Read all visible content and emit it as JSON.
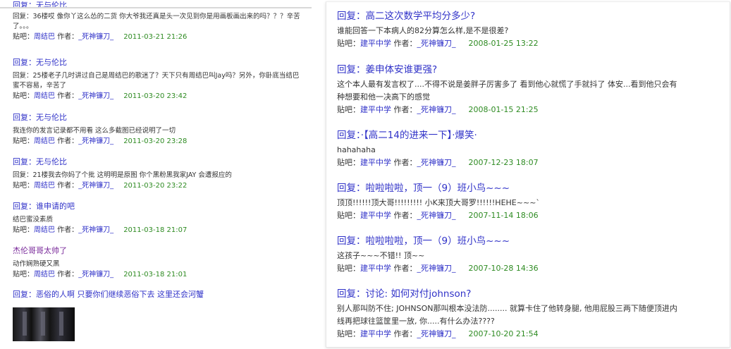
{
  "left": {
    "top_partial": "回复：无与伦比",
    "entries": [
      {
        "title": "",
        "summary": "回复：36楼哎 像你丫这么怂的二货 你大爷我还真是头一次见到你是用画板画出来的吗？？？辛苦了。。。",
        "bar": "周结巴",
        "author": "_死神镰刀_",
        "date": "2011-03-21 21:26"
      },
      {
        "title": "回复：无与伦比",
        "summary": "回复：25楼老子几时讲过自己是周结巴的歌迷了？天下只有周结巴叫Jay吗？另外，你卧底当结巴蜜不容易，辛苦了",
        "bar": "周结巴",
        "author": "_死神镰刀_",
        "date": "2011-03-20 23:42"
      },
      {
        "title": "回复：无与伦比",
        "summary": "我连你的发言记录都不用看 这么多截图已经说明了一切",
        "bar": "周结巴",
        "author": "_死神镰刀_",
        "date": "2011-03-20 23:28"
      },
      {
        "title": "回复：无与伦比",
        "summary": "回复：21楼我去你妈了个批 这明明是原图 你个黑粉黑我家JAY 会遭报应的",
        "bar": "周结巴",
        "author": "_死神镰刀_",
        "date": "2011-03-20 23:22"
      },
      {
        "title": "回复：谁申请的吧",
        "summary": "结巴蜜没素质",
        "bar": "周结巴",
        "author": "_死神镰刀_",
        "date": "2011-03-18 21:07"
      },
      {
        "title": "杰伦哥哥太帅了",
        "summary": "动作娴熟硬又黑",
        "bar": "周结巴",
        "author": "_死神镰刀_",
        "date": "2011-03-18 21:01"
      },
      {
        "title": "回复：恶俗的人啊 只要你们继续恶俗下去 这里还会河蟹",
        "summary": "",
        "bar": "",
        "author": "",
        "date": ""
      }
    ]
  },
  "right": {
    "entries": [
      {
        "title": "回复：高二这次数学平均分多少?",
        "summary": "谁能回答一下本病人的82分算怎么样,是不是很差?",
        "bar": "建平中学",
        "author": "_死神镰刀_",
        "date": "2008-01-25 13:22"
      },
      {
        "title": "回复：姜申体安谁更强?",
        "summary": "这个本人最有发言权了....不得不说是姜胖子厉害多了 看到他心就慌了手就抖了 体安...看到他只会有种想要和他一决高下的感觉",
        "bar": "建平中学",
        "author": "_死神镰刀_",
        "date": "2008-01-15 21:25"
      },
      {
        "title": "回复：·【高二14的进来一下】·爆笑·",
        "summary": "hahahaha",
        "bar": "建平中学",
        "author": "_死神镰刀_",
        "date": "2007-12-23 18:07"
      },
      {
        "title": "回复：啦啦啦啦，顶一（9）班小鸟~~~",
        "summary": "顶顶!!!!!!顶大哥!!!!!!!!! 小K来顶大哥罗!!!!!!HEHE~~~`",
        "bar": "建平中学",
        "author": "_死神镰刀_",
        "date": "2007-11-14 18:06"
      },
      {
        "title": "回复：啦啦啦啦，顶一（9）班小鸟~~~",
        "summary": "这孩子~~~不错!! 顶~~",
        "bar": "建平中学",
        "author": "_死神镰刀_",
        "date": "2007-10-28 14:36"
      },
      {
        "title": "回复：讨论: 如何对付johnson?",
        "summary": "别人那叫防不住; JOHNSON那叫根本没法防........ 就算卡住了他转身腿, 他用屁股三两下随便顶进内线再把球往篮筐里一放, 你.....有什么办法????",
        "bar": "建平中学",
        "author": "_死神镰刀_",
        "date": "2007-10-20 21:54"
      }
    ]
  },
  "labels": {
    "bar_prefix": "贴吧：",
    "author_prefix": " 作者："
  },
  "colors": {
    "link": "#3032c8",
    "visited": "#7a2a9a",
    "date": "#2e8b22",
    "text": "#333333"
  }
}
